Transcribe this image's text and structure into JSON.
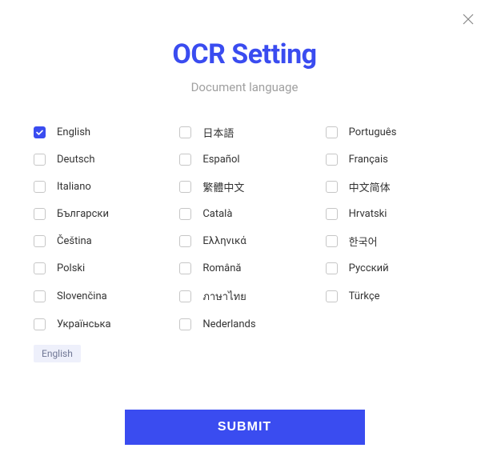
{
  "title": "OCR Setting",
  "subtitle": "Document language",
  "languages": {
    "col1": [
      "English",
      "Deutsch",
      "Italiano",
      "Български",
      "Čeština",
      "Polski",
      "Slovenčina",
      "Українська"
    ],
    "col2": [
      "日本語",
      "Español",
      "繁體中文",
      "Català",
      "Ελληνικά",
      "Română",
      "ภาษาไทย",
      "Nederlands"
    ],
    "col3": [
      "Português",
      "Français",
      "中文简体",
      "Hrvatski",
      "한국어",
      "Русский",
      "Türkçe"
    ]
  },
  "checked": [
    "English"
  ],
  "selected_tag": "English",
  "submit_label": "SUBMIT"
}
